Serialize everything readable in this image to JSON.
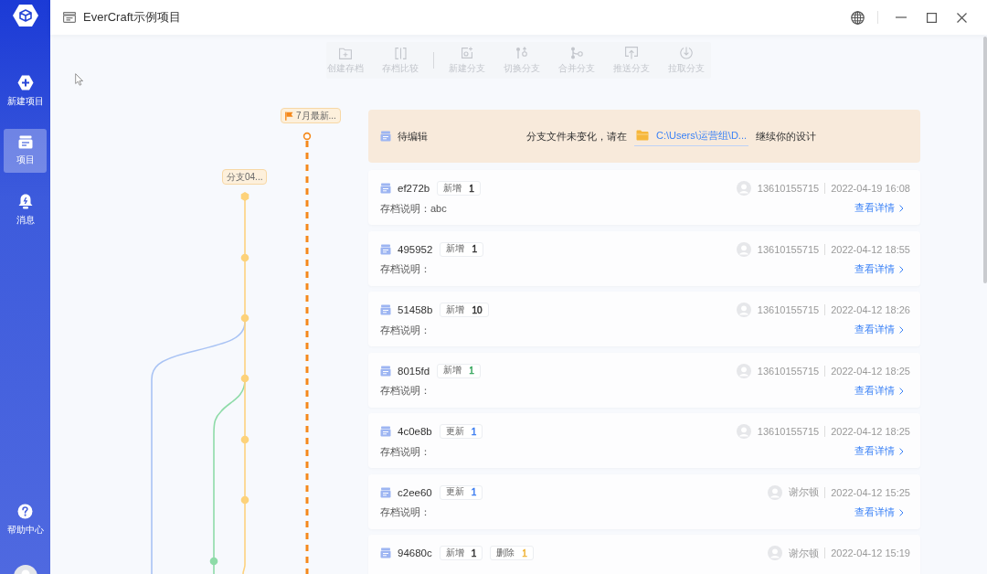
{
  "window": {
    "title": "EverCraft示例项目"
  },
  "sidebar": {
    "items": [
      {
        "label": "新建项目",
        "selected": false
      },
      {
        "label": "项目",
        "selected": true
      },
      {
        "label": "消息",
        "selected": false
      }
    ],
    "help": {
      "label": "帮助中心"
    }
  },
  "toolbar": {
    "groups": [
      [
        {
          "label": "创建存档",
          "disabled": true
        },
        {
          "label": "存档比较",
          "disabled": true
        }
      ],
      [
        {
          "label": "新建分支",
          "disabled": true
        },
        {
          "label": "切换分支",
          "disabled": true
        },
        {
          "label": "合并分支",
          "disabled": true
        },
        {
          "label": "推送分支",
          "disabled": true
        },
        {
          "label": "拉取分支",
          "disabled": true
        }
      ]
    ]
  },
  "graph": {
    "branches": [
      {
        "label": "7月最新...",
        "current": true
      },
      {
        "label": "分支04...",
        "current": false
      }
    ]
  },
  "pending": {
    "status": "待编辑",
    "message_before": "分支文件未变化，请在",
    "path": "C:\\Users\\运营组\\D...",
    "message_after": "继续你的设计"
  },
  "commits": [
    {
      "hash": "ef272b",
      "tags": [
        {
          "label": "新增",
          "count": "1",
          "color": "#333333"
        }
      ],
      "author": "13610155715",
      "time": "2022-04-19 16:08",
      "note": "存档说明：abc",
      "link": "查看详情"
    },
    {
      "hash": "495952",
      "tags": [
        {
          "label": "新增",
          "count": "1",
          "color": "#333333"
        }
      ],
      "author": "13610155715",
      "time": "2022-04-12 18:55",
      "note": "存档说明：",
      "link": "查看详情"
    },
    {
      "hash": "51458b",
      "tags": [
        {
          "label": "新增",
          "count": "10",
          "color": "#333333"
        }
      ],
      "author": "13610155715",
      "time": "2022-04-12 18:26",
      "note": "存档说明：",
      "link": "查看详情"
    },
    {
      "hash": "8015fd",
      "tags": [
        {
          "label": "新增",
          "count": "1",
          "color": "#3aa860"
        }
      ],
      "author": "13610155715",
      "time": "2022-04-12 18:25",
      "note": "存档说明：",
      "link": "查看详情"
    },
    {
      "hash": "4c0e8b",
      "tags": [
        {
          "label": "更新",
          "count": "1",
          "color": "#3b7cf0"
        }
      ],
      "author": "13610155715",
      "time": "2022-04-12 18:25",
      "note": "存档说明：",
      "link": "查看详情"
    },
    {
      "hash": "c2ee60",
      "tags": [
        {
          "label": "更新",
          "count": "1",
          "color": "#3b7cf0"
        }
      ],
      "author": "谢尔顿",
      "time": "2022-04-12 15:25",
      "note": "存档说明：",
      "link": "查看详情"
    },
    {
      "hash": "94680c",
      "tags": [
        {
          "label": "新增",
          "count": "1",
          "color": "#333333"
        },
        {
          "label": "删除",
          "count": "1",
          "color": "#f0b43a"
        }
      ],
      "author": "谢尔顿",
      "time": "2022-04-12 15:19"
    }
  ]
}
